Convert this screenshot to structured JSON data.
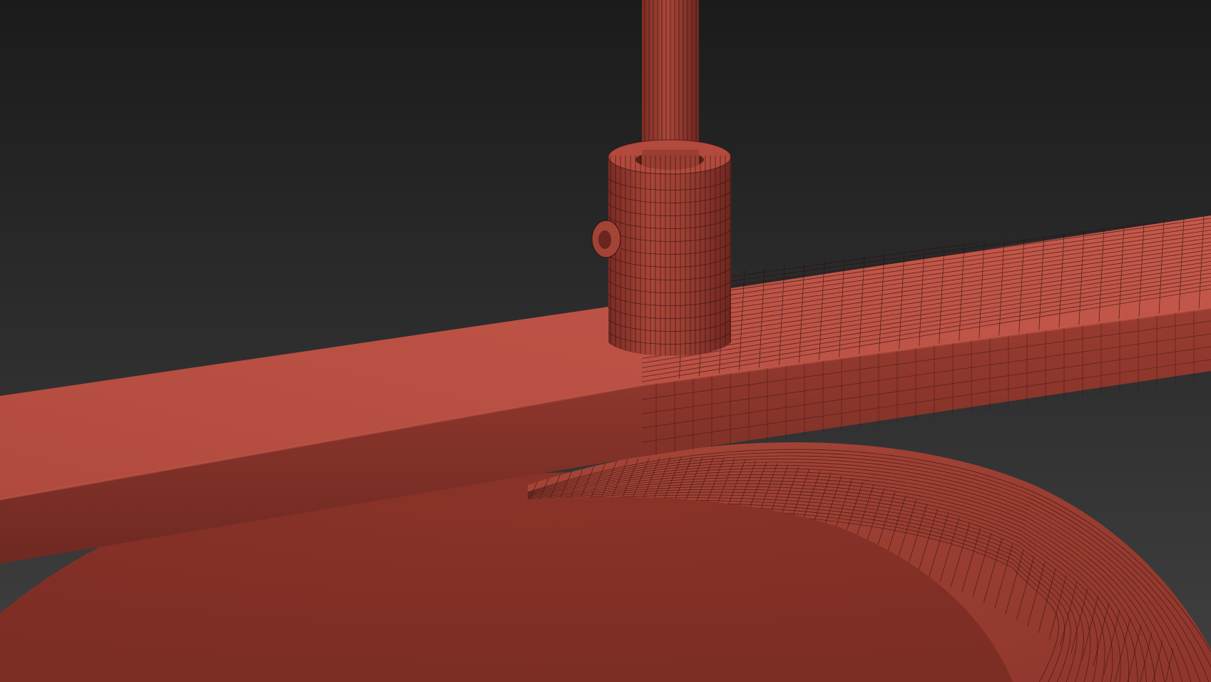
{
  "viewport": {
    "content": "3d-viewport",
    "background_top_color": "#1c1c1c",
    "background_bottom_color": "#3a3a3a",
    "mesh_color": "#a84539",
    "mesh_dark_color": "#7e2e25",
    "mesh_light_color": "#c0584a",
    "wire_color": "#2a0f0b"
  }
}
